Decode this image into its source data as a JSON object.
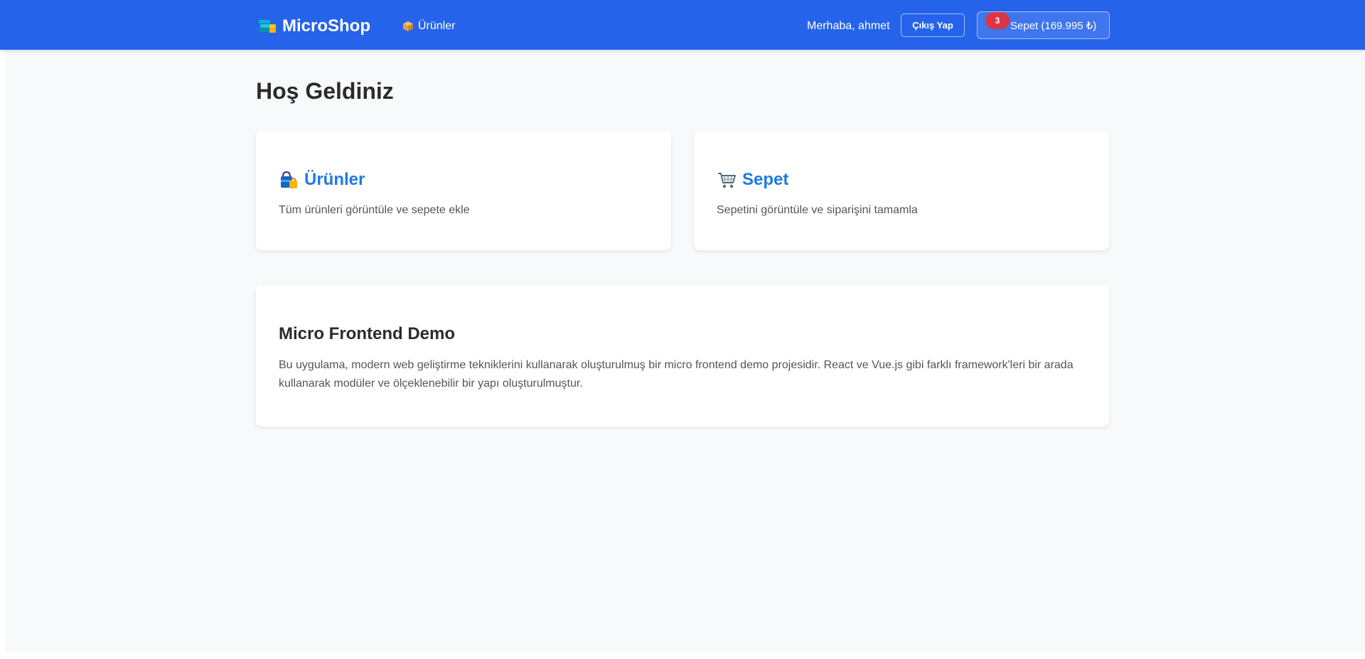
{
  "navbar": {
    "brand": "MicroShop",
    "products_link": "Ürünler",
    "greeting": "Merhaba, ahmet",
    "logout_label": "Çıkış Yap",
    "cart_label": "Sepet (169.995 ₺)",
    "cart_count": "3",
    "bg_color": "#2563eb",
    "badge_color": "#dc3545"
  },
  "main": {
    "title": "Hoş Geldiniz",
    "cards": [
      {
        "icon": "shopping-bags-icon",
        "title": "Ürünler",
        "description": "Tüm ürünleri görüntüle ve sepete ekle"
      },
      {
        "icon": "shopping-cart-icon",
        "title": "Sepet",
        "description": "Sepetini görüntüle ve siparişini tamamla"
      }
    ],
    "demo": {
      "title": "Micro Frontend Demo",
      "text": "Bu uygulama, modern web geliştirme tekniklerini kullanarak oluşturulmuş bir micro frontend demo projesidir. React ve Vue.js gibi farklı framework'leri bir arada kullanarak modüler ve ölçeklenebilir bir yapı oluşturulmuştur."
    },
    "accent_color": "#1f7ae0"
  }
}
